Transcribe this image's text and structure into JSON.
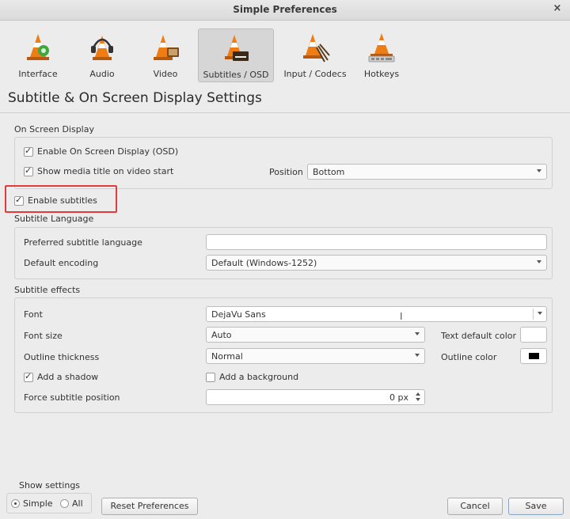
{
  "window": {
    "title": "Simple Preferences",
    "close": "×"
  },
  "tabs": [
    {
      "label": "Interface",
      "icon": "interface-cone-icon"
    },
    {
      "label": "Audio",
      "icon": "audio-cone-icon"
    },
    {
      "label": "Video",
      "icon": "video-cone-icon"
    },
    {
      "label": "Subtitles / OSD",
      "icon": "subtitles-cone-icon",
      "active": true
    },
    {
      "label": "Input / Codecs",
      "icon": "input-codecs-cone-icon"
    },
    {
      "label": "Hotkeys",
      "icon": "hotkeys-cone-icon"
    }
  ],
  "heading": "Subtitle & On Screen Display Settings",
  "osd": {
    "section": "On Screen Display",
    "enable_osd": "Enable On Screen Display (OSD)",
    "show_title": "Show media title on video start",
    "position_label": "Position",
    "position_value": "Bottom"
  },
  "enable_subtitles": "Enable subtitles",
  "language": {
    "section": "Subtitle Language",
    "preferred_label": "Preferred subtitle language",
    "preferred_value": "",
    "encoding_label": "Default encoding",
    "encoding_value": "Default (Windows-1252)"
  },
  "effects": {
    "section": "Subtitle effects",
    "font_label": "Font",
    "font_value": "DejaVu Sans",
    "font_size_label": "Font size",
    "font_size_value": "Auto",
    "text_color_label": "Text default color",
    "outline_label": "Outline thickness",
    "outline_value": "Normal",
    "outline_color_label": "Outline color",
    "shadow": "Add a shadow",
    "background": "Add a background",
    "force_pos_label": "Force subtitle position",
    "force_pos_value": "0 px"
  },
  "colors": {
    "text_default": "#ffffff",
    "outline": "#000000",
    "highlight": "#e23b3b"
  },
  "footer": {
    "show_settings": "Show settings",
    "simple": "Simple",
    "all": "All",
    "reset": "Reset Preferences",
    "cancel": "Cancel",
    "save": "Save"
  }
}
